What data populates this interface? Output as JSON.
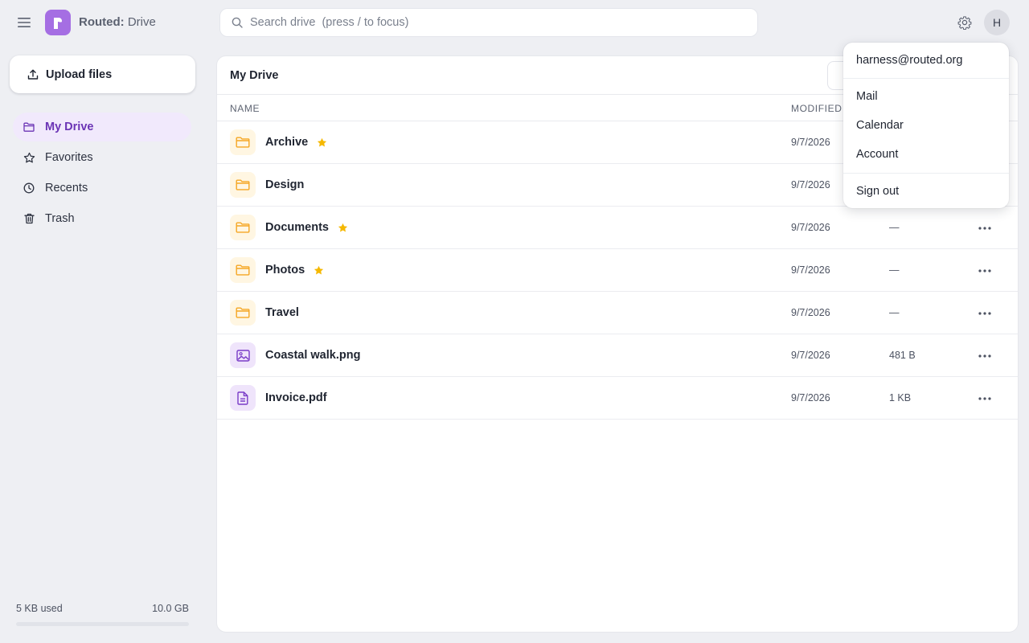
{
  "header": {
    "brand_strong": "Routed:",
    "brand_rest": " Drive",
    "logo_letter": "r",
    "search_placeholder": "Search drive  (press / to focus)",
    "avatar_initial": "H"
  },
  "sidebar": {
    "upload_label": "Upload files",
    "items": [
      {
        "label": "My Drive",
        "icon": "folder-icon",
        "active": true
      },
      {
        "label": "Favorites",
        "icon": "star-icon",
        "active": false
      },
      {
        "label": "Recents",
        "icon": "clock-icon",
        "active": false
      },
      {
        "label": "Trash",
        "icon": "trash-icon",
        "active": false
      }
    ],
    "storage": {
      "used": "5 KB used",
      "total": "10.0 GB",
      "fill_fraction": 0.0
    }
  },
  "main": {
    "title": "My Drive",
    "columns": {
      "name": "NAME",
      "modified": "MODIFIED"
    },
    "rows": [
      {
        "name": "Archive",
        "type": "folder",
        "starred": true,
        "modified": "9/7/2026",
        "size": ""
      },
      {
        "name": "Design",
        "type": "folder",
        "starred": false,
        "modified": "9/7/2026",
        "size": ""
      },
      {
        "name": "Documents",
        "type": "folder",
        "starred": true,
        "modified": "9/7/2026",
        "size": "—"
      },
      {
        "name": "Photos",
        "type": "folder",
        "starred": true,
        "modified": "9/7/2026",
        "size": "—"
      },
      {
        "name": "Travel",
        "type": "folder",
        "starred": false,
        "modified": "9/7/2026",
        "size": "—"
      },
      {
        "name": "Coastal walk.png",
        "type": "image",
        "starred": false,
        "modified": "9/7/2026",
        "size": "481 B"
      },
      {
        "name": "Invoice.pdf",
        "type": "document",
        "starred": false,
        "modified": "9/7/2026",
        "size": "1 KB"
      }
    ]
  },
  "dropdown": {
    "email": "harness@routed.org",
    "items": [
      "Mail",
      "Calendar",
      "Account"
    ],
    "sign_out": "Sign out"
  },
  "colors": {
    "accent": "#a56ee3",
    "accent_text": "#6b34b5",
    "folder": "#f5a623",
    "star": "#f5b800"
  }
}
